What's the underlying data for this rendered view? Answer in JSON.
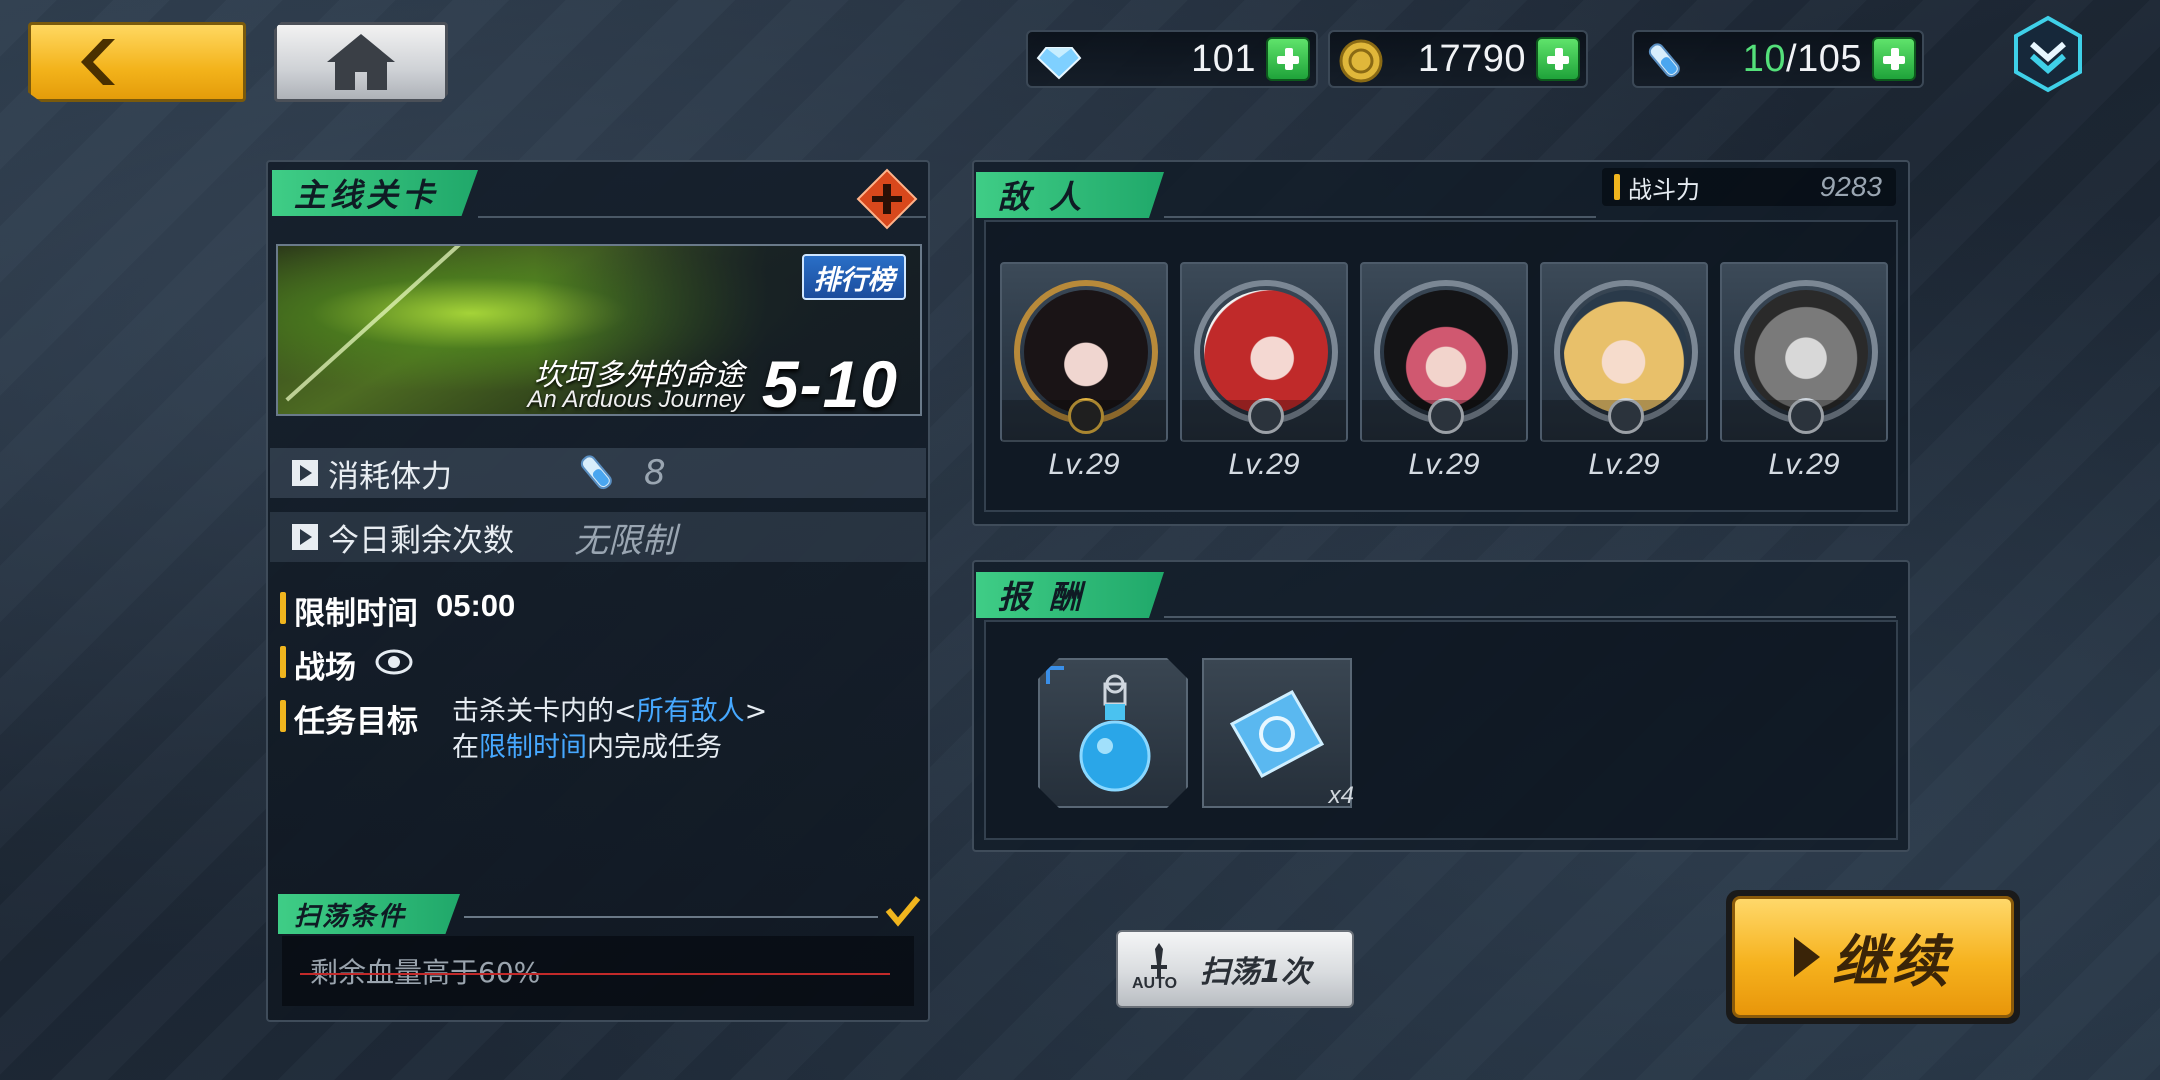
{
  "topbar": {
    "resources": [
      {
        "name": "diamond",
        "value": "101"
      },
      {
        "name": "coin",
        "value": "17790"
      },
      {
        "name": "stamina",
        "current": "10",
        "max": "/105"
      }
    ]
  },
  "stage": {
    "header": "主线关卡",
    "ranking_label": "排行榜",
    "title_cn": "坎坷多舛的命途",
    "title_en": "An Arduous Journey",
    "number": "5-10",
    "cost_label": "消耗体力",
    "cost_value": "8",
    "attempts_label": "今日剩余次数",
    "attempts_value": "无限制",
    "time_label": "限制时间",
    "time_value": "05:00",
    "field_label": "战场",
    "objective_label": "任务目标",
    "objective_line1_pre": "击杀关卡内的<",
    "objective_line1_hl": "所有敌人",
    "objective_line1_post": ">",
    "objective_line2_pre": "在",
    "objective_line2_hl": "限制时间",
    "objective_line2_post": "内完成任务",
    "sweep_header": "扫荡条件",
    "sweep_condition": "剩余血量高于60%"
  },
  "enemies": {
    "header": "敌 人",
    "power_label": "战斗力",
    "power_value": "9283",
    "list": [
      {
        "level": "Lv.29",
        "rank": "boss"
      },
      {
        "level": "Lv.29",
        "rank": "normal"
      },
      {
        "level": "Lv.29",
        "rank": "normal"
      },
      {
        "level": "Lv.29",
        "rank": "normal"
      },
      {
        "level": "Lv.29",
        "rank": "normal"
      }
    ]
  },
  "rewards": {
    "header": "报 酬",
    "items": [
      {
        "name": "blue-potion",
        "qty": ""
      },
      {
        "name": "blue-ticket",
        "qty": "x4"
      }
    ]
  },
  "actions": {
    "sweep_auto": "AUTO",
    "sweep_label": "扫荡1次",
    "continue_label": "继续"
  },
  "colors": {
    "accent_green": "#2fbf7a",
    "accent_gold": "#f0b51e",
    "highlight_blue": "#46a8ff"
  }
}
